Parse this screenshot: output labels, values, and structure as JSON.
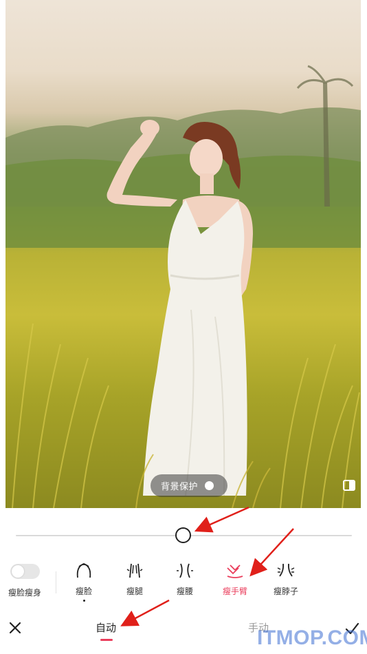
{
  "photo": {
    "background_protect_label": "背景保护"
  },
  "slider": {
    "value_fraction": 0.5
  },
  "body_toggle": {
    "label": "瘦脸瘦身",
    "enabled": false
  },
  "tools": [
    {
      "label": "瘦脸",
      "icon": "face-outline-icon",
      "selected_dot": true
    },
    {
      "label": "瘦腿",
      "icon": "leg-icon",
      "selected_dot": false
    },
    {
      "label": "瘦腰",
      "icon": "waist-icon",
      "selected_dot": false
    },
    {
      "label": "瘦手臂",
      "icon": "arm-icon",
      "selected_dot": false,
      "active": true
    },
    {
      "label": "瘦脖子",
      "icon": "neck-icon",
      "selected_dot": false
    }
  ],
  "bottom_bar": {
    "auto_label": "自动",
    "manual_label": "手动",
    "close_icon": "close-icon",
    "confirm_icon": "check-icon"
  },
  "watermark": "ITMOP.COM",
  "colors": {
    "accent": "#ea3e5c",
    "arrow": "#e0201a",
    "inactive_text": "#9a9a9a"
  }
}
